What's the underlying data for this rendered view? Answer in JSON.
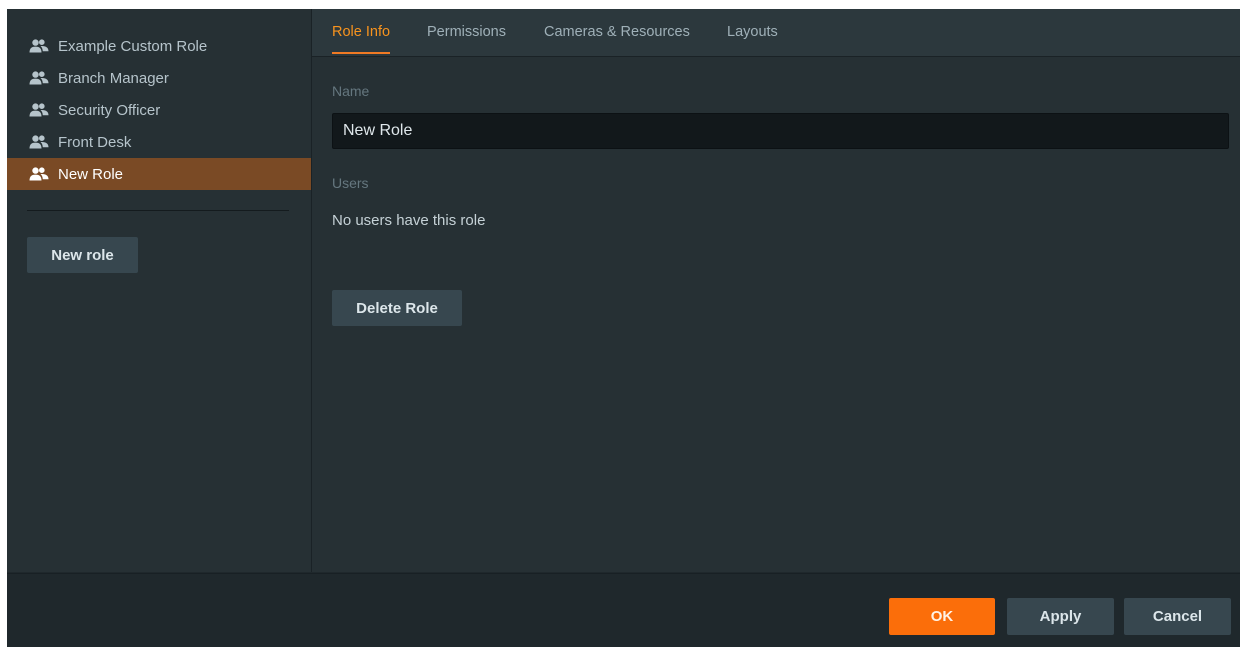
{
  "sidebar": {
    "roles": [
      {
        "label": "Example Custom Role"
      },
      {
        "label": "Branch Manager"
      },
      {
        "label": "Security Officer"
      },
      {
        "label": "Front Desk"
      },
      {
        "label": "New Role",
        "selected": true
      }
    ],
    "role_icon": "users-icon",
    "new_role_label": "New role"
  },
  "tabs": [
    {
      "label": "Role Info",
      "active": true
    },
    {
      "label": "Permissions"
    },
    {
      "label": "Cameras & Resources"
    },
    {
      "label": "Layouts"
    }
  ],
  "role_info": {
    "name_label": "Name",
    "name_value": "New Role",
    "users_label": "Users",
    "users_empty_text": "No users have this role",
    "delete_label": "Delete Role"
  },
  "footer": {
    "ok_label": "OK",
    "apply_label": "Apply",
    "cancel_label": "Cancel"
  },
  "colors": {
    "accent": "#f07a24",
    "selected_row": "#7a4a25",
    "panel_bg": "#263034",
    "window_bg": "#1f282c"
  }
}
